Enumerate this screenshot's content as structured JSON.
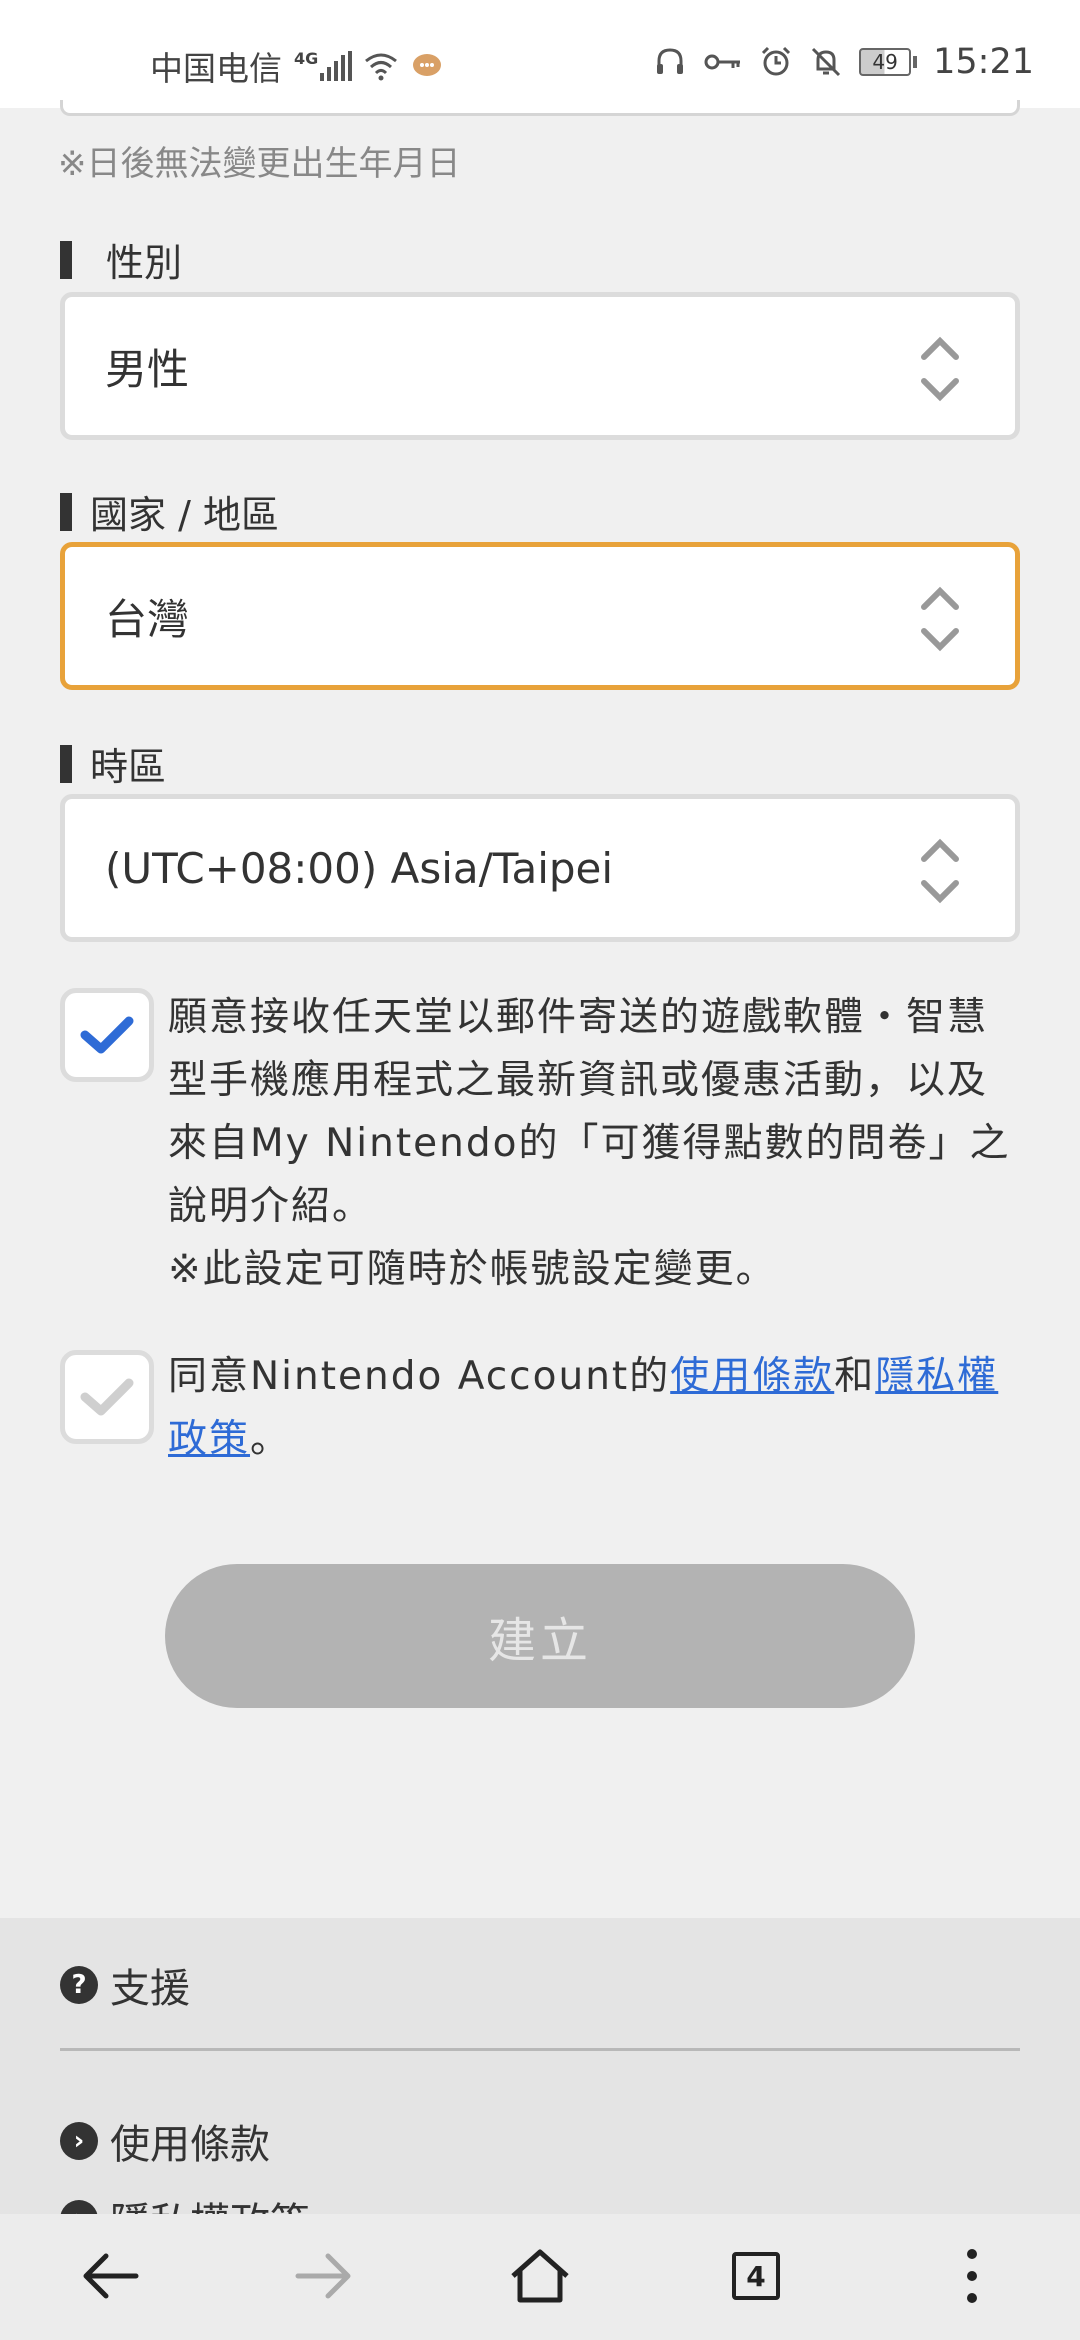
{
  "status_bar": {
    "carrier": "中国电信",
    "network": "4G",
    "battery": "49",
    "time": "15:21"
  },
  "form": {
    "dob_note": "※日後無法變更出生年月日",
    "gender": {
      "label": "性別",
      "value": "男性"
    },
    "country": {
      "label": "國家 / 地區",
      "value": "台灣"
    },
    "timezone": {
      "label": "時區",
      "value": "(UTC+08:00) Asia/Taipei"
    },
    "newsletter": {
      "checked": true,
      "text": "願意接收任天堂以郵件寄送的遊戲軟體・智慧型手機應用程式之最新資訊或優惠活動，以及來自My Nintendo的「可獲得點數的問卷」之說明介紹。",
      "note": "※此設定可隨時於帳號設定變更。"
    },
    "terms": {
      "checked": false,
      "prefix": "同意Nintendo Account的",
      "terms_link": "使用條款",
      "and": "和",
      "privacy_link": "隱私權政策",
      "suffix": "。"
    },
    "create_button": "建立"
  },
  "footer": {
    "support": "支援",
    "terms": "使用條款",
    "privacy": "隱私權政策"
  },
  "nav": {
    "tab_count": "4"
  },
  "colors": {
    "focus_border": "#e8a23a",
    "link": "#2e6bd6",
    "check_active": "#2e6bd6",
    "check_inactive": "#cfcfcf",
    "disabled_button": "#b3b3b3"
  }
}
